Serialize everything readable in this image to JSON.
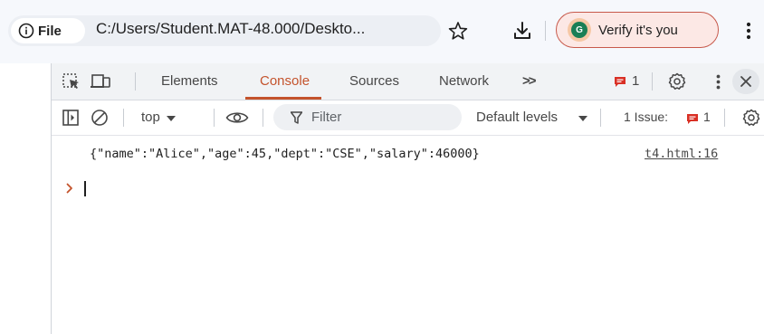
{
  "browser": {
    "site_info_label": "File",
    "url": "C:/Users/Student.MAT-48.000/Deskto...",
    "verify_label": "Verify it's you",
    "avatar_letter": "G",
    "icons": [
      "info-icon",
      "star-icon",
      "download-icon",
      "kebab-menu-icon"
    ]
  },
  "devtools": {
    "tabs": [
      {
        "label": "Elements"
      },
      {
        "label": "Console"
      },
      {
        "label": "Sources"
      },
      {
        "label": "Network"
      }
    ],
    "active_tab": "Console",
    "more_tabs_label": ">>",
    "message_count": "1",
    "toolbar": {
      "context": "top",
      "filter_placeholder": "Filter",
      "levels": "Default levels",
      "issues_label": "1 Issue:",
      "issues_count": "1"
    },
    "console": {
      "log_text": "{\"name\":\"Alice\",\"age\":45,\"dept\":\"CSE\",\"salary\":46000}",
      "source": "t4.html:16",
      "prompt": ">"
    },
    "colors": {
      "accent": "#c4532c",
      "message_badge": "#d93025",
      "verify_border": "#c7594b"
    }
  }
}
